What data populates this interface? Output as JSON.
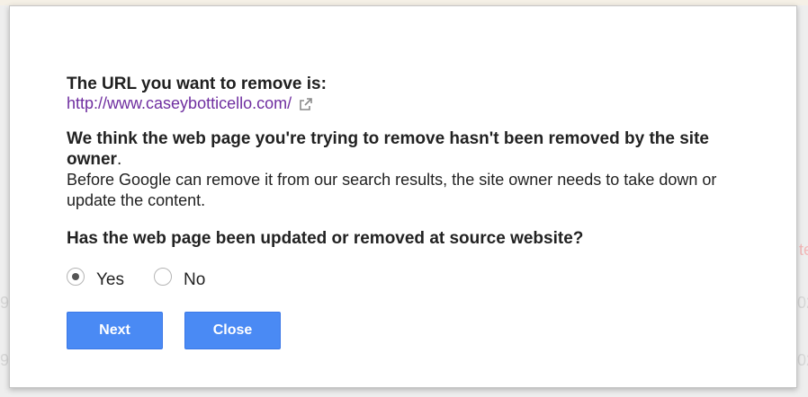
{
  "background": {
    "ghost_texts": [
      {
        "text": "te",
        "tone": "red"
      },
      {
        "text": "9/",
        "tone": "grey"
      },
      {
        "text": "02",
        "tone": "grey"
      },
      {
        "text": "9/",
        "tone": "grey"
      },
      {
        "text": "02",
        "tone": "grey"
      }
    ]
  },
  "dialog": {
    "heading": "The URL you want to remove is:",
    "url": "http://www.caseybotticello.com/",
    "url_icon": "external-link-icon",
    "notice_bold": "We think the web page you're trying to remove hasn't been removed by the site owner",
    "notice_period": ".",
    "notice_body": "Before Google can remove it from our search results, the site owner needs to take down or update the content.",
    "question": "Has the web page been updated or removed at source website?",
    "options": [
      {
        "label": "Yes",
        "selected": true
      },
      {
        "label": "No",
        "selected": false
      }
    ],
    "next_label": "Next",
    "close_label": "Close"
  },
  "colors": {
    "button": "#4a8af4",
    "link": "#6f2ea0"
  }
}
